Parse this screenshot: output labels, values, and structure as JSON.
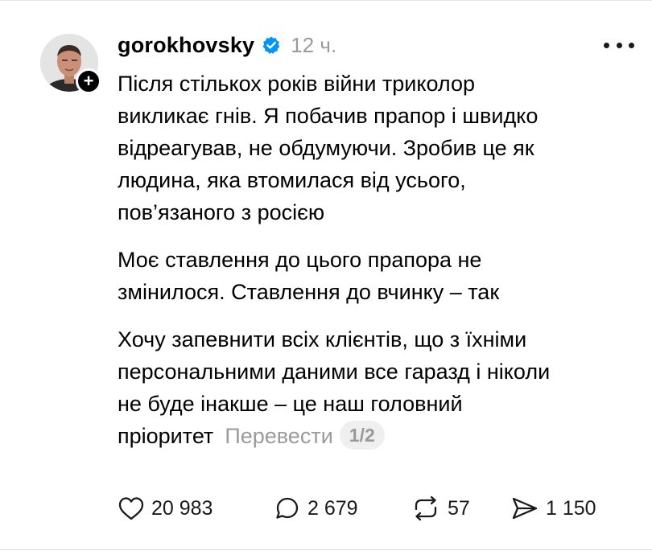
{
  "post": {
    "author": {
      "username": "gorokhovsky",
      "verified": true,
      "avatar_icon": "user-photo",
      "follow_badge": "+"
    },
    "time_ago": "12 ч.",
    "more_icon": "more-horizontal-icon",
    "paragraphs": [
      [
        "Після стількох років війни триколор",
        "викликає гнів. Я побачив прапор і швидко",
        "відреагував, не обдумуючи. Зробив це як",
        "людина, яка втомилася від усього,",
        "пов’язаного з росією"
      ],
      [
        "Моє ставлення до цього прапора не",
        "змінилося. Ставлення до вчинку – так"
      ],
      [
        "Хочу запевнити всіх клієнтів, що з їхніми",
        "персональними даними все гаразд і ніколи",
        "не буде інакше – це наш головний",
        "пріоритет"
      ]
    ],
    "translate_label": "Перевести",
    "pagination": "1/2",
    "actions": {
      "likes": "20 983",
      "replies": "2 679",
      "reposts": "57",
      "shares": "1 150"
    }
  },
  "colors": {
    "text": "#000000",
    "muted": "#9b9b9b",
    "verified": "#0095f6",
    "pill_bg": "#efefef"
  }
}
